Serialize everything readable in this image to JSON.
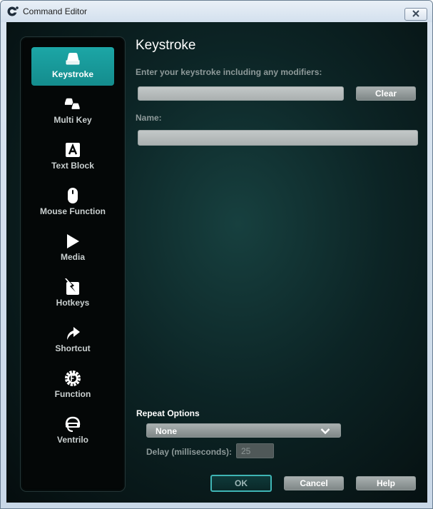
{
  "window": {
    "title": "Command Editor"
  },
  "sidebar": {
    "items": [
      {
        "label": "Keystroke",
        "icon": "keystroke-key-icon",
        "active": true
      },
      {
        "label": "Multi Key",
        "icon": "multi-key-icon",
        "active": false
      },
      {
        "label": "Text Block",
        "icon": "text-block-icon",
        "active": false
      },
      {
        "label": "Mouse Function",
        "icon": "mouse-icon",
        "active": false
      },
      {
        "label": "Media",
        "icon": "play-icon",
        "active": false
      },
      {
        "label": "Hotkeys",
        "icon": "hotkeys-icon",
        "active": false
      },
      {
        "label": "Shortcut",
        "icon": "shortcut-arrow-icon",
        "active": false
      },
      {
        "label": "Function",
        "icon": "function-gear-icon",
        "active": false
      },
      {
        "label": "Ventrilo",
        "icon": "ventrilo-headset-icon",
        "active": false
      }
    ]
  },
  "main": {
    "heading": "Keystroke",
    "keystroke_label": "Enter your keystroke including any modifiers:",
    "keystroke_value": "",
    "clear_label": "Clear",
    "name_label": "Name:",
    "name_value": ""
  },
  "repeat": {
    "title": "Repeat Options",
    "selected": "None",
    "delay_label": "Delay (milliseconds):",
    "delay_value": "25"
  },
  "footer": {
    "ok": "OK",
    "cancel": "Cancel",
    "help": "Help"
  },
  "colors": {
    "accent": "#1ca6a6",
    "background": "#0c2425",
    "sidebar": "#040707"
  }
}
